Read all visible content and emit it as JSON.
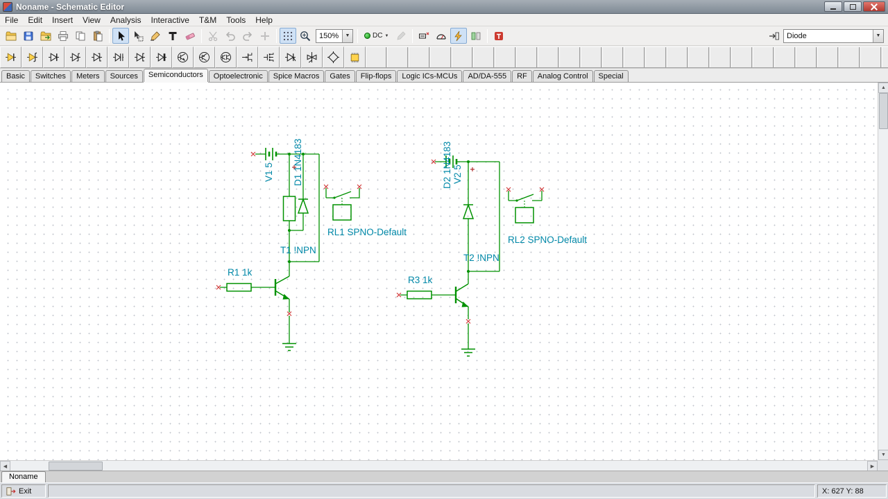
{
  "window": {
    "title": "Noname - Schematic Editor"
  },
  "menu": {
    "items": [
      "File",
      "Edit",
      "Insert",
      "View",
      "Analysis",
      "Interactive",
      "T&M",
      "Tools",
      "Help"
    ]
  },
  "toolbar": {
    "zoom_value": "150%",
    "dc_label": "DC",
    "component_filter_value": "Diode"
  },
  "component_tabs": {
    "items": [
      "Basic",
      "Switches",
      "Meters",
      "Sources",
      "Semiconductors",
      "Optoelectronic",
      "Spice Macros",
      "Gates",
      "Flip-flops",
      "Logic ICs-MCUs",
      "AD/DA-555",
      "RF",
      "Analog Control",
      "Special"
    ],
    "active": "Semiconductors"
  },
  "schematic": {
    "components": {
      "v1": "V1 5",
      "d1": "D1 1N4183",
      "rl1": "RL1 SPNO-Default",
      "t1": "T1 !NPN",
      "r1": "R1 1k",
      "v2": "V2 5",
      "d2": "D2 1N4183",
      "rl2": "RL2 SPNO-Default",
      "t2": "T2 !NPN",
      "r3": "R3 1k"
    }
  },
  "document_tabs": {
    "items": [
      "Noname"
    ]
  },
  "statusbar": {
    "exit_label": "Exit",
    "cursor_position": "X: 627 Y: 88"
  },
  "icons": {
    "arrow_up": "▲",
    "arrow_down": "▼",
    "arrow_left": "◀",
    "arrow_right": "▶"
  },
  "colors": {
    "wire_green": "#009100",
    "label_teal": "#0088a8",
    "pin_red": "#d23b3b",
    "pressed_blue": "#cfe1f5"
  }
}
